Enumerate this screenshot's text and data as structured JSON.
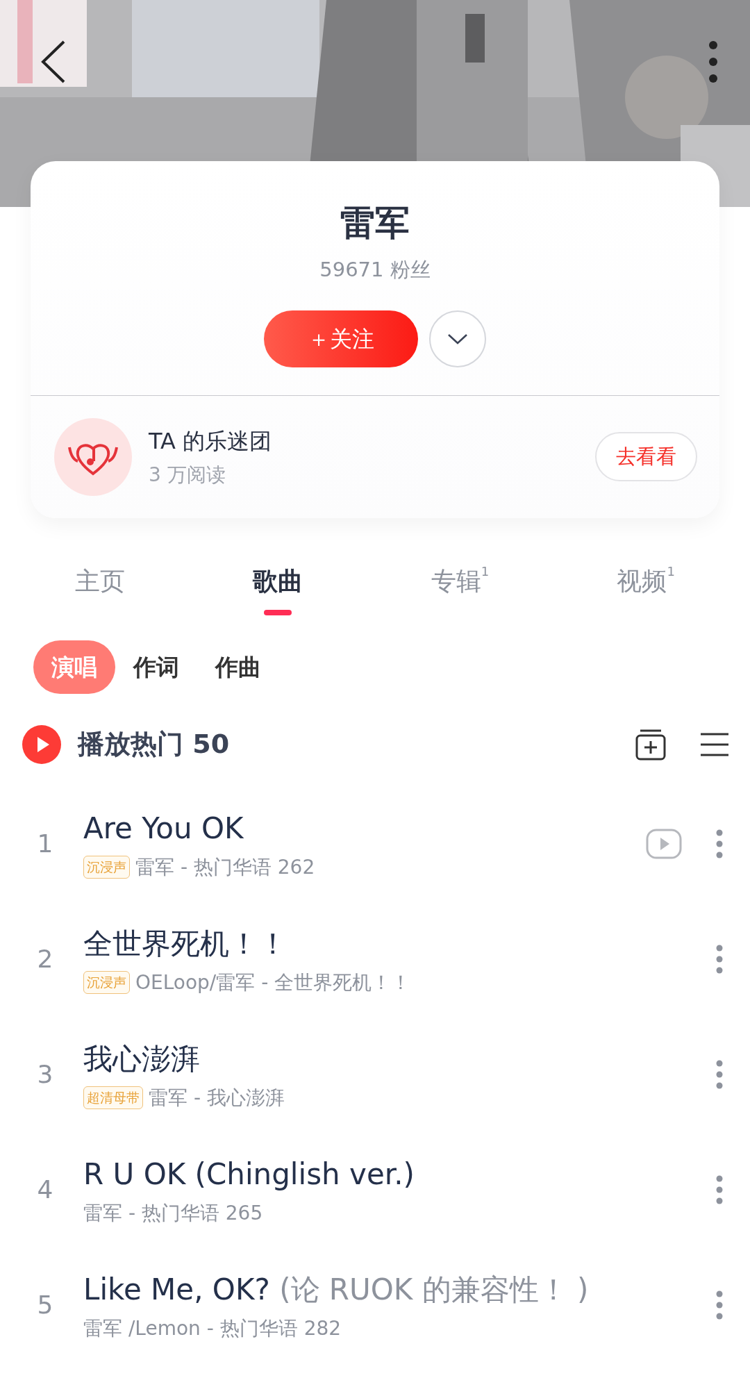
{
  "artist": {
    "name": "雷军",
    "fans": "59671 粉丝",
    "follow_label": "＋关注"
  },
  "fan_club": {
    "title": "TA 的乐迷团",
    "subtitle": "3 万阅读",
    "button": "去看看"
  },
  "tabs": [
    {
      "label": "主页",
      "selected": false
    },
    {
      "label": "歌曲",
      "selected": true
    },
    {
      "label": "专辑",
      "count": "1",
      "selected": false
    },
    {
      "label": "视频",
      "count": "1",
      "selected": false
    }
  ],
  "filters": [
    {
      "label": "演唱",
      "selected": true
    },
    {
      "label": "作词",
      "selected": false
    },
    {
      "label": "作曲",
      "selected": false
    }
  ],
  "play_all": {
    "label": "播放热门 50"
  },
  "songs": [
    {
      "index": "1",
      "title": "Are You OK",
      "tag": "沉浸声",
      "meta": "雷军 - 热门华语 262",
      "has_mv": true
    },
    {
      "index": "2",
      "title": "全世界死机！！",
      "tag": "沉浸声",
      "meta": "OELoop/雷军 - 全世界死机！！",
      "has_mv": false
    },
    {
      "index": "3",
      "title": "我心澎湃",
      "tag": "超清母带",
      "meta": "雷军 - 我心澎湃",
      "has_mv": false
    },
    {
      "index": "4",
      "title": "R U OK (Chinglish ver.)",
      "meta": "雷军 - 热门华语 265",
      "has_mv": false
    },
    {
      "index": "5",
      "title": "Like Me, OK?",
      "note": "(论 RUOK 的兼容性！ )",
      "meta": "雷军 /Lemon - 热门华语 282",
      "has_mv": false
    }
  ]
}
